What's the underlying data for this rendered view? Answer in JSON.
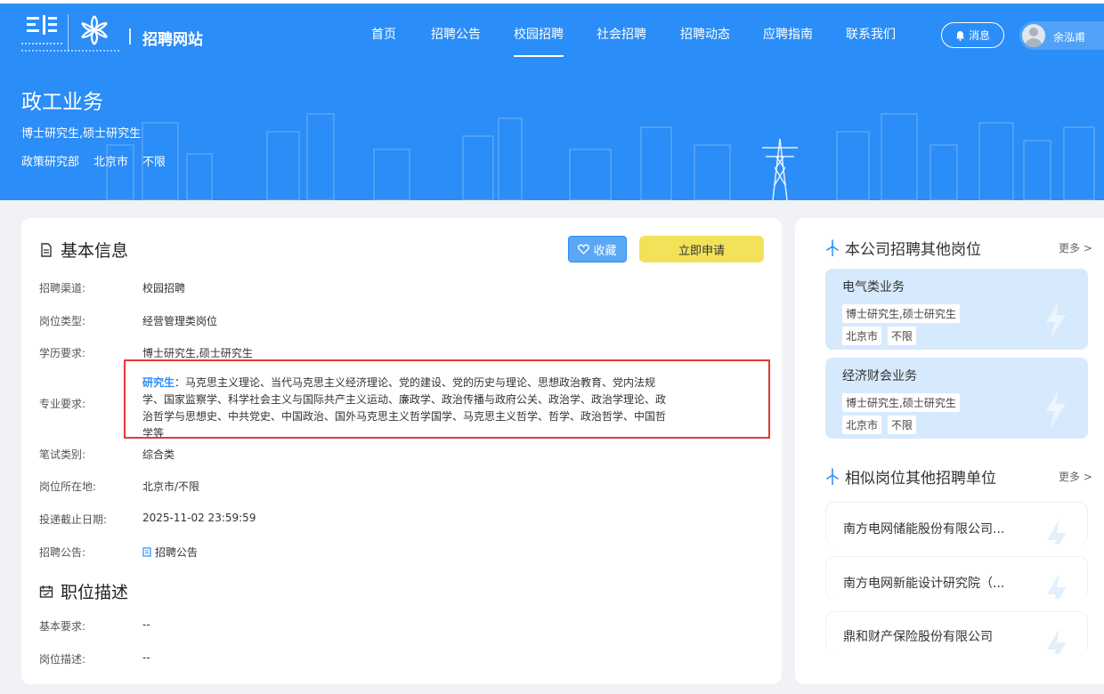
{
  "header": {
    "site_title": "招聘网站",
    "nav": [
      {
        "label": "首页",
        "active": false
      },
      {
        "label": "招聘公告",
        "active": false
      },
      {
        "label": "校园招聘",
        "active": true
      },
      {
        "label": "社会招聘",
        "active": false
      },
      {
        "label": "招聘动态",
        "active": false
      },
      {
        "label": "应聘指南",
        "active": false
      },
      {
        "label": "联系我们",
        "active": false
      }
    ],
    "message_label": "消息",
    "user_name": "余泓甫",
    "icons": {
      "logo_left": "china-southern-grid-logo",
      "logo_right": "anniversary-emblem-icon",
      "message": "bell-icon",
      "avatar": "user-avatar-icon"
    }
  },
  "banner": {
    "title": "政工业务",
    "education": "博士研究生,硕士研究生",
    "department": "政策研究部",
    "city": "北京市",
    "district": "不限"
  },
  "basic_info": {
    "section_title": "基本信息",
    "favorite_label": "收藏",
    "apply_label": "立即申请",
    "rows": [
      {
        "label": "招聘渠道:",
        "value": "校园招聘"
      },
      {
        "label": "岗位类型:",
        "value": "经营管理类岗位"
      },
      {
        "label": "学历要求:",
        "value": "博士研究生,硕士研究生"
      }
    ],
    "major": {
      "label": "专业要求:",
      "highlight": "研究生",
      "text": "：马克思主义理论、当代马克思主义经济理论、党的建设、党的历史与理论、思想政治教育、党内法规学、国家监察学、科学社会主义与国际共产主义运动、廉政学、政治传播与政府公关、政治学、政治学理论、政治哲学与思想史、中共党史、中国政治、国外马克思主义哲学国学、马克思主义哲学、哲学、政治哲学、中国哲学等"
    },
    "rows2": [
      {
        "label": "笔试类别:",
        "value": "综合类"
      },
      {
        "label": "岗位所在地:",
        "value": "北京市/不限"
      },
      {
        "label": "投递截止日期:",
        "value": "2025-11-02 23:59:59"
      }
    ],
    "notice": {
      "label": "招聘公告:",
      "link": "招聘公告"
    }
  },
  "job_desc": {
    "section_title": "职位描述",
    "rows": [
      {
        "label": "基本要求:",
        "value": "--"
      },
      {
        "label": "岗位描述:",
        "value": "--"
      }
    ]
  },
  "sidebar": {
    "other_positions": {
      "title": "本公司招聘其他岗位",
      "more": "更多 >",
      "items": [
        {
          "title": "电气类业务",
          "education": "博士研究生,硕士研究生",
          "city": "北京市",
          "district": "不限"
        },
        {
          "title": "经济财会业务",
          "education": "博士研究生,硕士研究生",
          "city": "北京市",
          "district": "不限"
        }
      ]
    },
    "similar_units": {
      "title": "相似岗位其他招聘单位",
      "more": "更多 >",
      "items": [
        {
          "name": "南方电网储能股份有限公司..."
        },
        {
          "name": "南方电网新能设计研究院（..."
        },
        {
          "name": "鼎和财产保险股份有限公司"
        }
      ]
    }
  },
  "colors": {
    "primary": "#2b8df7",
    "apply": "#f2e25a",
    "highlight_border": "#e53935",
    "card_blue": "#d7e9fd"
  }
}
